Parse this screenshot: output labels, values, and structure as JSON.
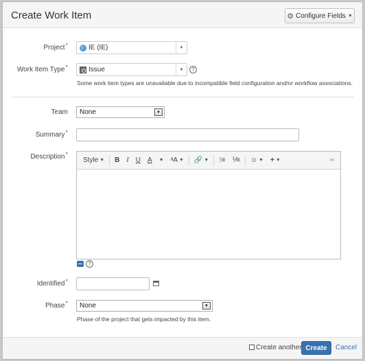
{
  "dialog": {
    "title": "Create Work Item",
    "configure_fields_label": "Configure Fields"
  },
  "fields": {
    "project": {
      "label": "Project",
      "value": "IE (IE)"
    },
    "work_item_type": {
      "label": "Work Item Type",
      "value": "Issue",
      "note": "Some work item types are unavailable due to incompatible field configuration and/or workflow associations."
    },
    "team": {
      "label": "Team",
      "value": "None"
    },
    "summary": {
      "label": "Summary",
      "value": ""
    },
    "description": {
      "label": "Description",
      "value": ""
    },
    "identified": {
      "label": "Identified",
      "value": ""
    },
    "phase": {
      "label": "Phase",
      "value": "None",
      "note": "Phase of the project that gets impacted by this item."
    }
  },
  "editor": {
    "toolbar": {
      "style_label": "Style",
      "bold": "B",
      "italic": "I",
      "underline": "U",
      "text_color": "A",
      "more_text": "ᵃA",
      "link": "🔗",
      "bullet_list": "•≡",
      "numbered_list": "1≡",
      "emoticon": "☺",
      "insert": "+",
      "collapse": "✂"
    }
  },
  "footer": {
    "create_another_label": "Create another",
    "create_label": "Create",
    "cancel_label": "Cancel"
  },
  "colors": {
    "primary": "#3572b0",
    "required": "#d04437"
  }
}
